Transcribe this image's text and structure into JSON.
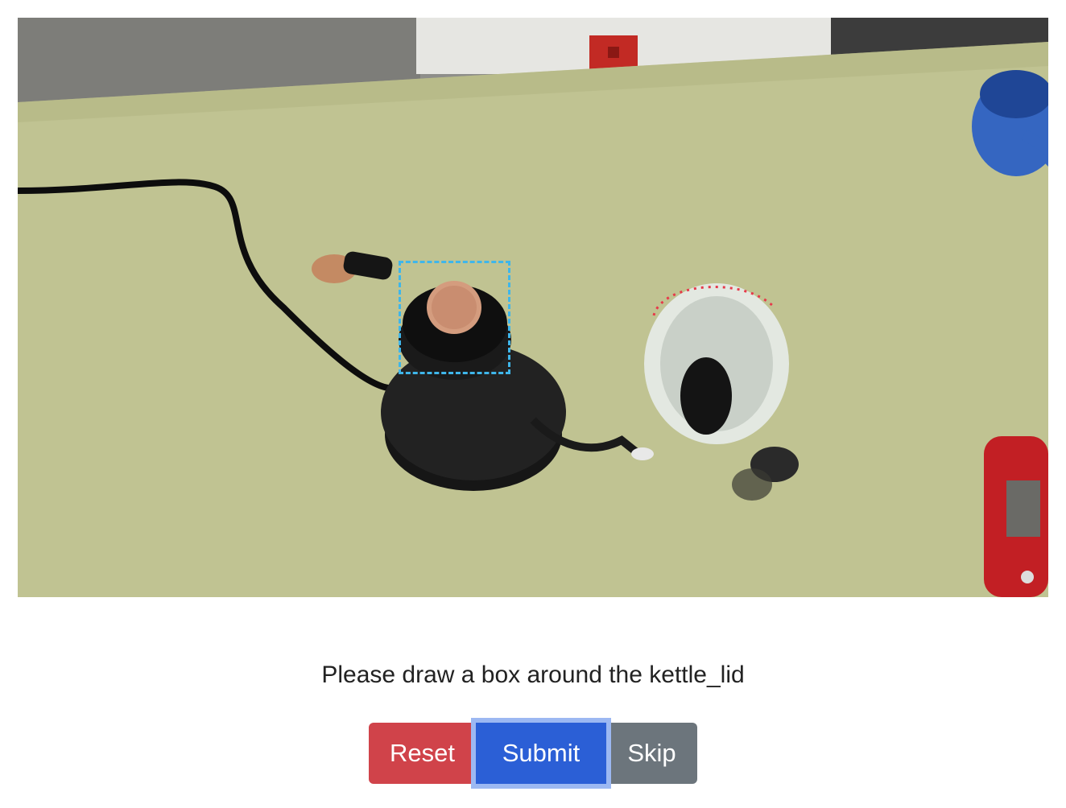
{
  "scene": {
    "description_icon": "kettle-photo",
    "annotation_color": "#3fb6ea"
  },
  "prompt": {
    "text": "Please draw a box around the kettle_lid"
  },
  "buttons": {
    "reset_label": "Reset",
    "submit_label": "Submit",
    "skip_label": "Skip",
    "reset_color": "#d0434a",
    "submit_color": "#2b5fd6",
    "skip_color": "#6c757c"
  }
}
